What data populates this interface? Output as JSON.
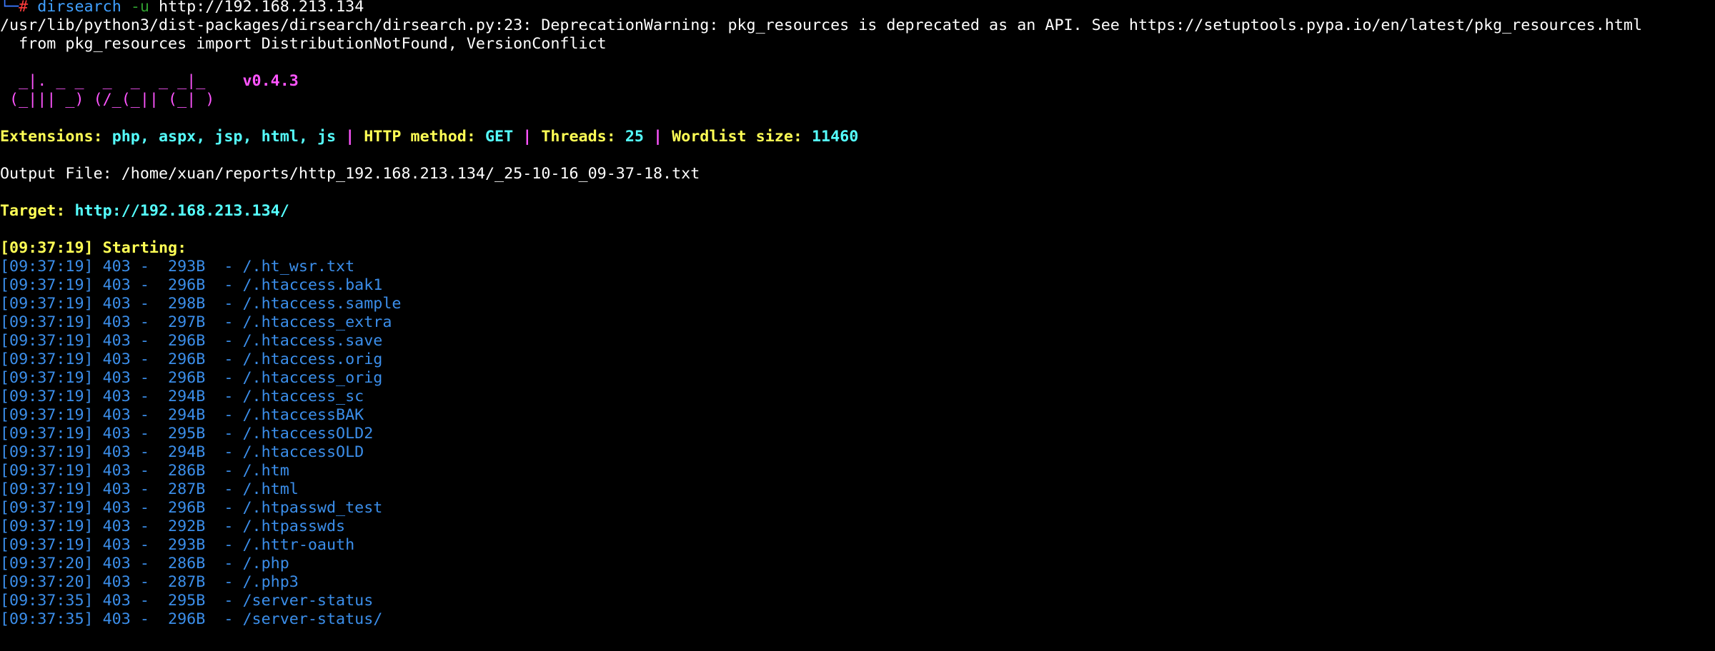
{
  "prompt": {
    "corner": "└─",
    "hash": "# ",
    "command": "dirsearch",
    "flag": "-u",
    "argument": "http://192.168.213.134"
  },
  "warning": {
    "line1": "/usr/lib/python3/dist-packages/dirsearch/dirsearch.py:23: DeprecationWarning: pkg_resources is deprecated as an API. See https://setuptools.pypa.io/en/latest/pkg_resources.html",
    "line2": "  from pkg_resources import DistributionNotFound, VersionConflict"
  },
  "logo": {
    "line1": "  _|. _ _  _  _  _ _|_    ",
    "line2": " (_||| _) (/_(_|| (_| )   ",
    "version": "v0.4.3"
  },
  "config": {
    "extensions_label": "Extensions: ",
    "extensions_value": "php, aspx, jsp, html, js",
    "separator": " | ",
    "method_label": "HTTP method: ",
    "method_value": "GET",
    "threads_label": "Threads: ",
    "threads_value": "25",
    "wordlist_label": "Wordlist size: ",
    "wordlist_value": "11460"
  },
  "output": {
    "label": "Output File: ",
    "path": "/home/xuan/reports/http_192.168.213.134/_25-10-16_09-37-18.txt"
  },
  "target": {
    "label": "Target: ",
    "url": "http://192.168.213.134/"
  },
  "starting": {
    "time": "[09:37:19]",
    "label": " Starting:"
  },
  "results": [
    {
      "text": "[09:37:19] 403 -  293B  - /.ht_wsr.txt"
    },
    {
      "text": "[09:37:19] 403 -  296B  - /.htaccess.bak1"
    },
    {
      "text": "[09:37:19] 403 -  298B  - /.htaccess.sample"
    },
    {
      "text": "[09:37:19] 403 -  297B  - /.htaccess_extra"
    },
    {
      "text": "[09:37:19] 403 -  296B  - /.htaccess.save"
    },
    {
      "text": "[09:37:19] 403 -  296B  - /.htaccess.orig"
    },
    {
      "text": "[09:37:19] 403 -  296B  - /.htaccess_orig"
    },
    {
      "text": "[09:37:19] 403 -  294B  - /.htaccess_sc"
    },
    {
      "text": "[09:37:19] 403 -  294B  - /.htaccessBAK"
    },
    {
      "text": "[09:37:19] 403 -  295B  - /.htaccessOLD2"
    },
    {
      "text": "[09:37:19] 403 -  294B  - /.htaccessOLD"
    },
    {
      "text": "[09:37:19] 403 -  286B  - /.htm"
    },
    {
      "text": "[09:37:19] 403 -  287B  - /.html"
    },
    {
      "text": "[09:37:19] 403 -  296B  - /.htpasswd_test"
    },
    {
      "text": "[09:37:19] 403 -  292B  - /.htpasswds"
    },
    {
      "text": "[09:37:19] 403 -  293B  - /.httr-oauth"
    },
    {
      "text": "[09:37:20] 403 -  286B  - /.php"
    },
    {
      "text": "[09:37:20] 403 -  287B  - /.php3"
    },
    {
      "text": "[09:37:35] 403 -  295B  - /server-status"
    },
    {
      "text": "[09:37:35] 403 -  296B  - /server-status/"
    }
  ]
}
